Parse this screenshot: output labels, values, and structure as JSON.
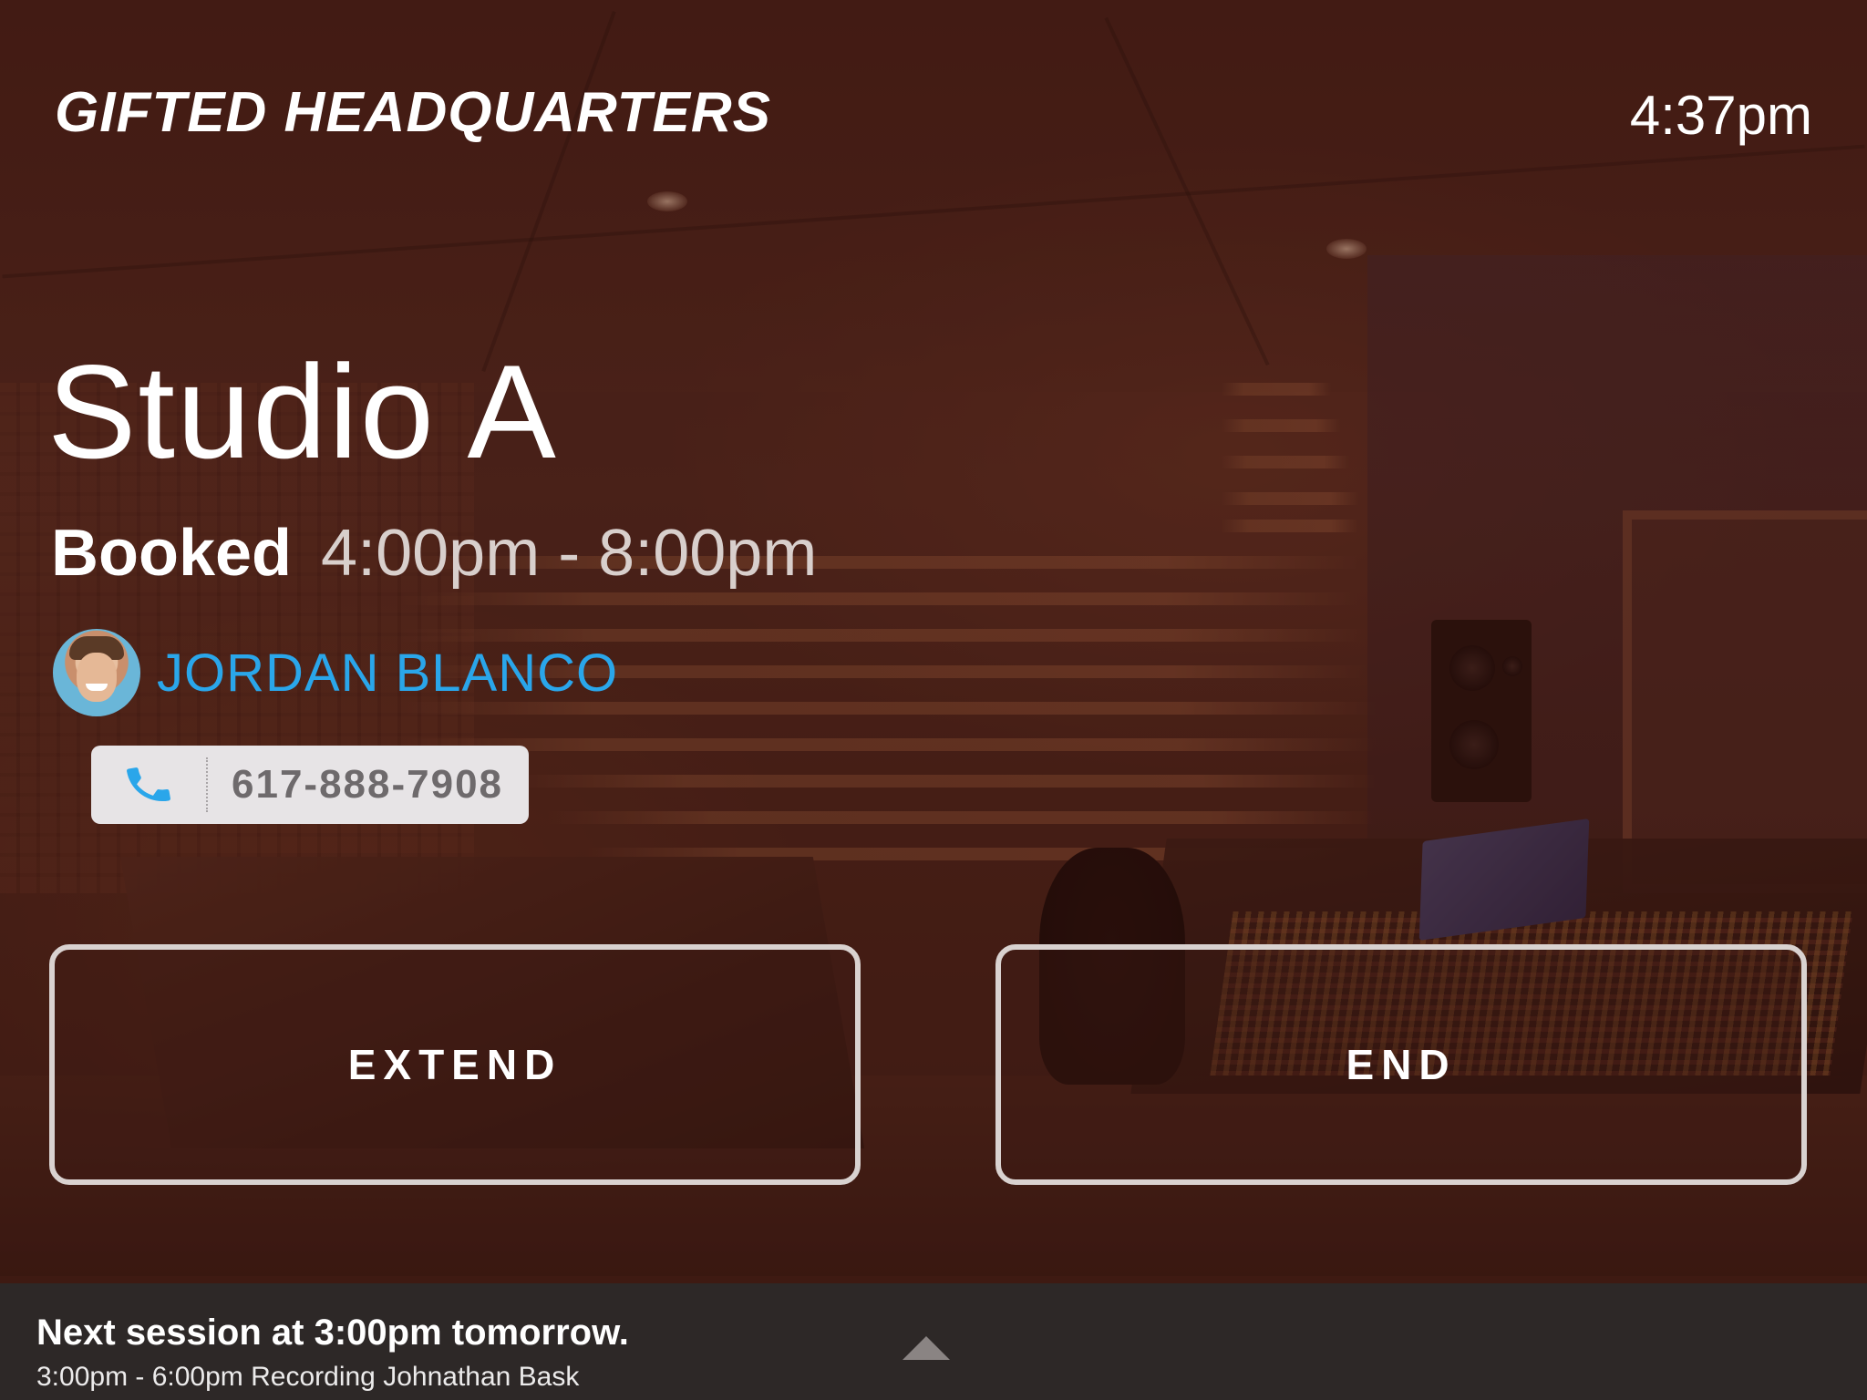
{
  "header": {
    "venue_name": "GIFTED HEADQUARTERS",
    "current_time": "4:37pm"
  },
  "room": {
    "name": "Studio A",
    "status": "Booked",
    "time_range": "4:00pm - 8:00pm"
  },
  "guest": {
    "name": "JORDAN BLANCO",
    "phone": "617-888-7908"
  },
  "actions": {
    "extend_label": "EXTEND",
    "end_label": "END"
  },
  "next_session": {
    "headline": "Next session at 3:00pm tomorrow.",
    "detail": "3:00pm - 6:00pm Recording Johnathan Bask"
  },
  "colors": {
    "guest_link": "#2aa6ea",
    "phone_icon": "#2aa6ea",
    "bottom_bar": "#2d2827",
    "overlay": "#3c1610"
  },
  "icons": {
    "phone": "phone-icon",
    "expand": "chevron-up-icon",
    "avatar": "avatar"
  }
}
